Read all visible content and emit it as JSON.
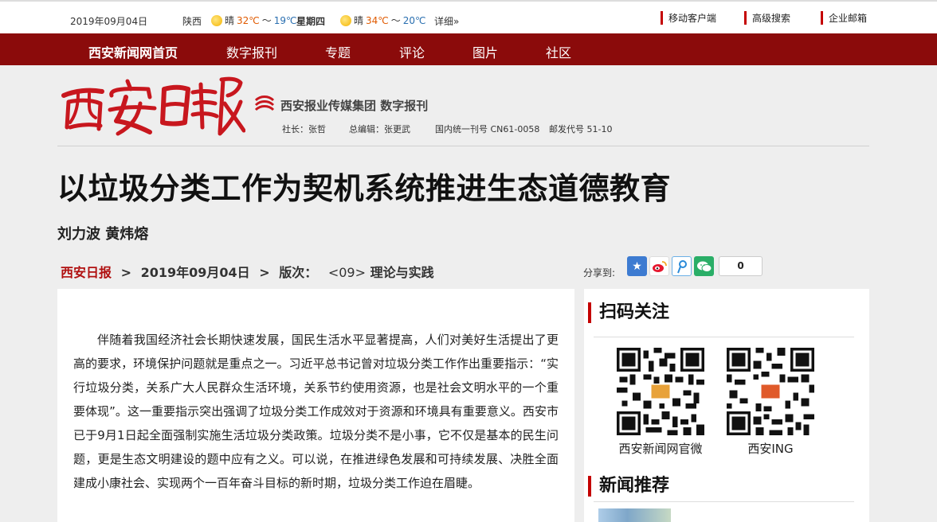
{
  "topbar": {
    "date": "2019年09月04日",
    "city": "陕西",
    "weather_today": {
      "cond": "晴",
      "high": "32℃",
      "sep": "～",
      "low": "19℃"
    },
    "weekday": "星期四",
    "weather_tomorrow": {
      "cond": "晴",
      "high": "34℃",
      "sep": "～",
      "low": "20℃"
    },
    "detail": "详细»",
    "links": [
      "移动客户端",
      "高级搜索",
      "企业邮箱"
    ]
  },
  "nav": [
    "西安新闻网首页",
    "数字报刊",
    "专题",
    "评论",
    "图片",
    "社区"
  ],
  "masthead": {
    "logo_text": "西安日報",
    "group": "西安报业传媒集团 数字报刊",
    "president": "社长：张哲",
    "chief_editor": "总编辑：张更武",
    "cn_number": "国内统一刊号 CN61-0058",
    "postal_code": "邮发代号 51-10"
  },
  "article": {
    "title": "以垃圾分类工作为契机系统推进生态道德教育",
    "authors": "刘力波 黄炜熔",
    "source": "西安日报",
    "sep": ">",
    "date": "2019年09月04日",
    "edition_label": "版次：",
    "edition": "<09>",
    "section": "理论与实践",
    "body": "伴随着我国经济社会长期快速发展，国民生活水平显著提高，人们对美好生活提出了更高的要求，环境保护问题就是重点之一。习近平总书记曾对垃圾分类工作作出重要指示：“实行垃圾分类，关系广大人民群众生活环境，关系节约使用资源，也是社会文明水平的一个重要体现”。这一重要指示突出强调了垃圾分类工作成效对于资源和环境具有重要意义。西安市已于9月1日起全面强制实施生活垃圾分类政策。垃圾分类不是小事，它不仅是基本的民生问题，更是生态文明建设的题中应有之义。可以说，在推进绿色发展和可持续发展、决胜全面建成小康社会、实现两个一百年奋斗目标的新时期，垃圾分类工作迫在眉睫。"
  },
  "share": {
    "label": "分享到:",
    "icons": [
      "qzone-icon",
      "weibo-icon",
      "tencent-weibo-icon",
      "wechat-icon"
    ],
    "count": "0"
  },
  "sidebar": {
    "scan_title": "扫码关注",
    "qr_codes": [
      {
        "label": "西安新闻网官微",
        "badge": "西安新闻网"
      },
      {
        "label": "西安ING",
        "badge": "ING"
      }
    ],
    "news_title": "新闻推荐"
  },
  "colors": {
    "nav_bg": "#8b0b0b",
    "accent": "#c40000",
    "source_link": "#b01010"
  }
}
